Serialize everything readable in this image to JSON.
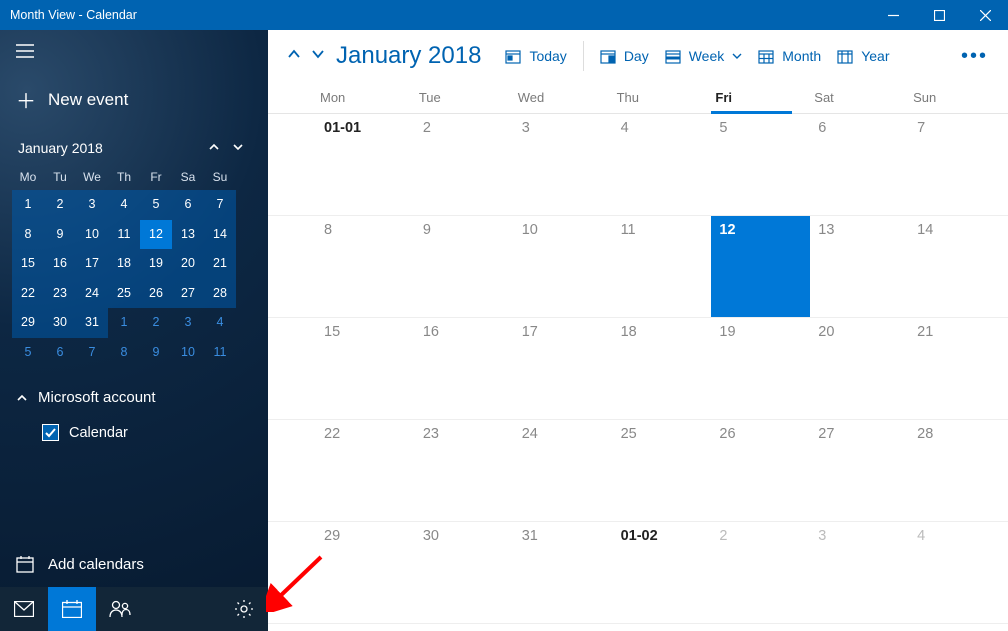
{
  "window": {
    "title": "Month View - Calendar"
  },
  "sidebar": {
    "new_event": "New event",
    "mini": {
      "title": "January 2018",
      "dow": [
        "Mo",
        "Tu",
        "We",
        "Th",
        "Fr",
        "Sa",
        "Su"
      ],
      "cells": [
        {
          "n": "1",
          "s": 1
        },
        {
          "n": "2",
          "s": 1
        },
        {
          "n": "3",
          "s": 1
        },
        {
          "n": "4",
          "s": 1
        },
        {
          "n": "5",
          "s": 1
        },
        {
          "n": "6",
          "s": 1
        },
        {
          "n": "7",
          "s": 1
        },
        {
          "n": "8",
          "s": 1
        },
        {
          "n": "9",
          "s": 1
        },
        {
          "n": "10",
          "s": 1
        },
        {
          "n": "11",
          "s": 1
        },
        {
          "n": "12",
          "s": 2
        },
        {
          "n": "13",
          "s": 1
        },
        {
          "n": "14",
          "s": 1
        },
        {
          "n": "15",
          "s": 1
        },
        {
          "n": "16",
          "s": 1
        },
        {
          "n": "17",
          "s": 1
        },
        {
          "n": "18",
          "s": 1
        },
        {
          "n": "19",
          "s": 1
        },
        {
          "n": "20",
          "s": 1
        },
        {
          "n": "21",
          "s": 1
        },
        {
          "n": "22",
          "s": 1
        },
        {
          "n": "23",
          "s": 1
        },
        {
          "n": "24",
          "s": 1
        },
        {
          "n": "25",
          "s": 1
        },
        {
          "n": "26",
          "s": 1
        },
        {
          "n": "27",
          "s": 1
        },
        {
          "n": "28",
          "s": 1
        },
        {
          "n": "29",
          "s": 1
        },
        {
          "n": "30",
          "s": 1
        },
        {
          "n": "31",
          "s": 1
        },
        {
          "n": "1",
          "s": 3
        },
        {
          "n": "2",
          "s": 3
        },
        {
          "n": "3",
          "s": 3
        },
        {
          "n": "4",
          "s": 3
        },
        {
          "n": "5",
          "s": 3
        },
        {
          "n": "6",
          "s": 3
        },
        {
          "n": "7",
          "s": 3
        },
        {
          "n": "8",
          "s": 3
        },
        {
          "n": "9",
          "s": 3
        },
        {
          "n": "10",
          "s": 3
        },
        {
          "n": "11",
          "s": 3
        }
      ]
    },
    "account": {
      "label": "Microsoft account",
      "expanded": true
    },
    "calendar": {
      "label": "Calendar",
      "checked": true
    },
    "add": "Add calendars"
  },
  "toolbar": {
    "title": "January 2018",
    "today": "Today",
    "views": {
      "day": "Day",
      "week": "Week",
      "month": "Month",
      "year": "Year"
    },
    "active_view": "Month"
  },
  "grid": {
    "dow": [
      "Mon",
      "Tue",
      "Wed",
      "Thu",
      "Fri",
      "Sat",
      "Sun"
    ],
    "today_col": 4,
    "weeks": [
      [
        {
          "t": "01-01",
          "c": "first"
        },
        {
          "t": "2"
        },
        {
          "t": "3"
        },
        {
          "t": "4"
        },
        {
          "t": "5"
        },
        {
          "t": "6"
        },
        {
          "t": "7"
        }
      ],
      [
        {
          "t": "8"
        },
        {
          "t": "9"
        },
        {
          "t": "10"
        },
        {
          "t": "11"
        },
        {
          "t": "12",
          "c": "selected"
        },
        {
          "t": "13"
        },
        {
          "t": "14"
        }
      ],
      [
        {
          "t": "15"
        },
        {
          "t": "16"
        },
        {
          "t": "17"
        },
        {
          "t": "18"
        },
        {
          "t": "19"
        },
        {
          "t": "20"
        },
        {
          "t": "21"
        }
      ],
      [
        {
          "t": "22"
        },
        {
          "t": "23"
        },
        {
          "t": "24"
        },
        {
          "t": "25"
        },
        {
          "t": "26"
        },
        {
          "t": "27"
        },
        {
          "t": "28"
        }
      ],
      [
        {
          "t": "29"
        },
        {
          "t": "30"
        },
        {
          "t": "31"
        },
        {
          "t": "01-02",
          "c": "double"
        },
        {
          "t": "2",
          "c": "ghost"
        },
        {
          "t": "3",
          "c": "ghost"
        },
        {
          "t": "4",
          "c": "ghost"
        }
      ]
    ]
  }
}
